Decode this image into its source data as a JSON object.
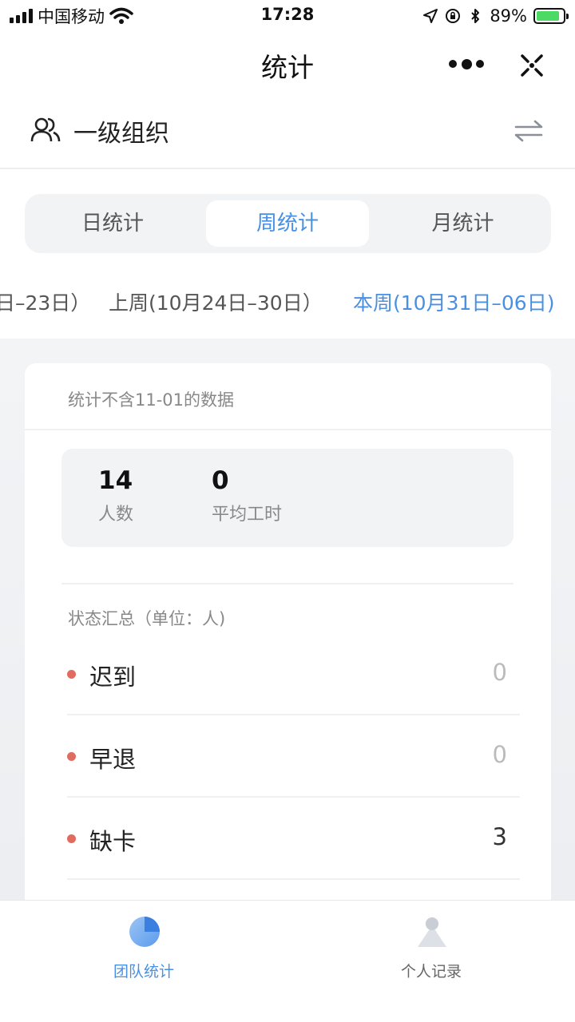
{
  "status_bar": {
    "carrier": "中国移动",
    "time": "17:28",
    "battery_percent": "89%",
    "battery_level": 0.89
  },
  "nav": {
    "title": "统计"
  },
  "org": {
    "name": "一级组织"
  },
  "tabs": [
    {
      "label": "日统计",
      "active": false
    },
    {
      "label": "周统计",
      "active": true
    },
    {
      "label": "月统计",
      "active": false
    }
  ],
  "weeks": [
    {
      "label": "日–23日）",
      "active": false
    },
    {
      "label": "上周(10月24日–30日）",
      "active": false
    },
    {
      "label": "本周(10月31日–06日)",
      "active": true
    }
  ],
  "card": {
    "note": "统计不含11-01的数据",
    "stats": [
      {
        "value": "14",
        "label": "人数"
      },
      {
        "value": "0",
        "label": "平均工时"
      }
    ],
    "status_heading": "状态汇总（单位：人)",
    "status_rows": [
      {
        "label": "迟到",
        "count": "0"
      },
      {
        "label": "早退",
        "count": "0"
      },
      {
        "label": "缺卡",
        "count": "3"
      }
    ]
  },
  "bottom_tabs": [
    {
      "label": "团队统计",
      "icon": "pie-chart-icon",
      "active": true
    },
    {
      "label": "个人记录",
      "icon": "person-icon",
      "active": false
    }
  ],
  "colors": {
    "accent": "#4a90e2",
    "status_dot": "#e06b5f",
    "battery": "#4cd964"
  }
}
